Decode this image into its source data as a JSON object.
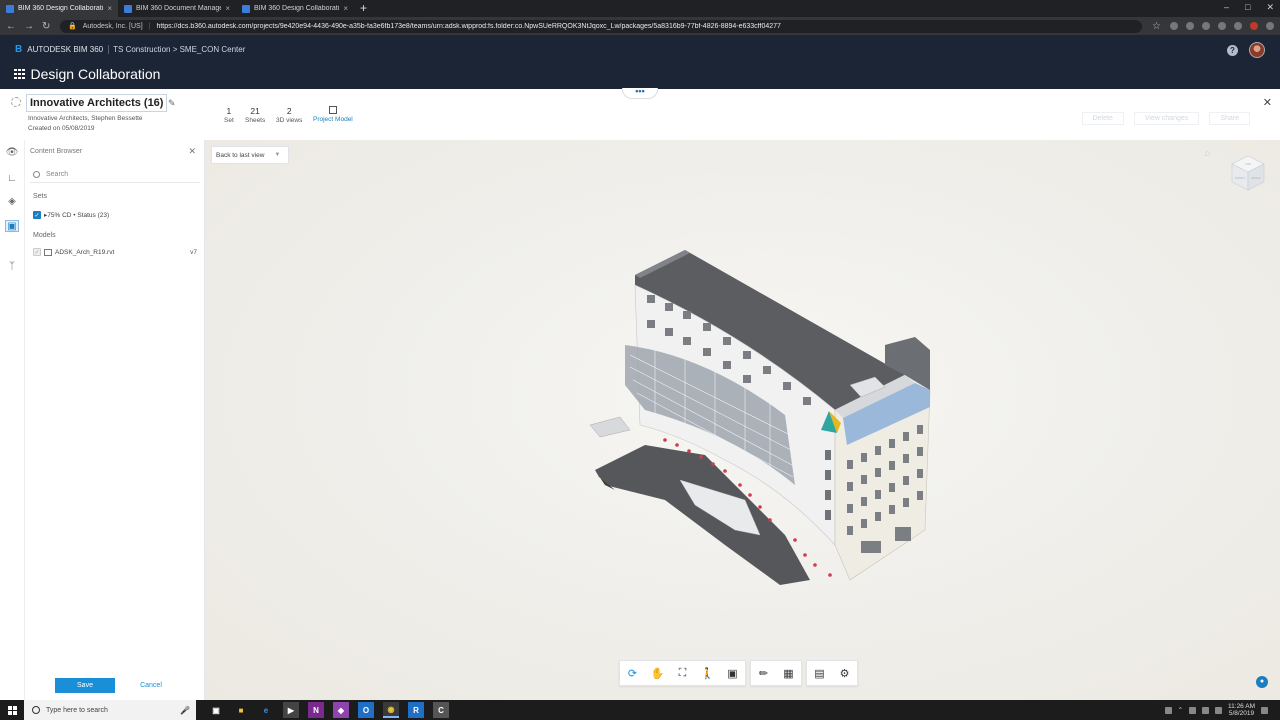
{
  "browser": {
    "tabs": [
      {
        "label": "BIM 360 Design Collaboration",
        "active": true
      },
      {
        "label": "BIM 360 Document Management",
        "active": false
      },
      {
        "label": "BIM 360 Design Collaboration",
        "active": false
      }
    ],
    "tab_close": "×",
    "new_tab": "+",
    "site_info": "Autodesk, Inc. [US]",
    "url": "https://dcs.b360.autodesk.com/projects/9e420e94-4436-490e-a35b-fa3e6fb173e8/teams/urn:adsk.wipprod:fs.folder:co.NpwSUeRRQOK3NtJqoxc_Lw/packages/5a8316b9-77bf-4826-8894-e633cff04277"
  },
  "header": {
    "brand": "AUTODESK  BIM 360",
    "project": "TS Construction > SME_CON Center",
    "app_title": "Design Collaboration",
    "help": "?"
  },
  "package": {
    "name": "Innovative Architects (16)",
    "author": "Innovative Architects, Stephen Bessette",
    "created": "Created on 05/08/2019",
    "stats": [
      {
        "value": "1",
        "label": "Set"
      },
      {
        "value": "21",
        "label": "Sheets"
      },
      {
        "value": "2",
        "label": "3D views"
      }
    ],
    "project_model_label": "Project Model",
    "more": "•••",
    "ghost_buttons": [
      "Delete",
      "View changes",
      "Share"
    ]
  },
  "content_browser": {
    "title": "Content Browser",
    "search_placeholder": "Search",
    "sets_label": "Sets",
    "set_item": "▸75% CD • Status (23)",
    "models_label": "Models",
    "model_item": "ADSK_Arch_R19.rvt",
    "model_version": "v7",
    "save": "Save",
    "cancel": "Cancel"
  },
  "viewer": {
    "back_to_last_view": "Back to last view",
    "viewcube_labels": [
      "TOP",
      "FRONT",
      "RIGHT"
    ]
  },
  "taskbar": {
    "search_placeholder": "Type here to search",
    "time": "11:26 AM",
    "date": "5/8/2019"
  },
  "colors": {
    "accent": "#1a8fd8",
    "header_bg": "#1b2536"
  }
}
